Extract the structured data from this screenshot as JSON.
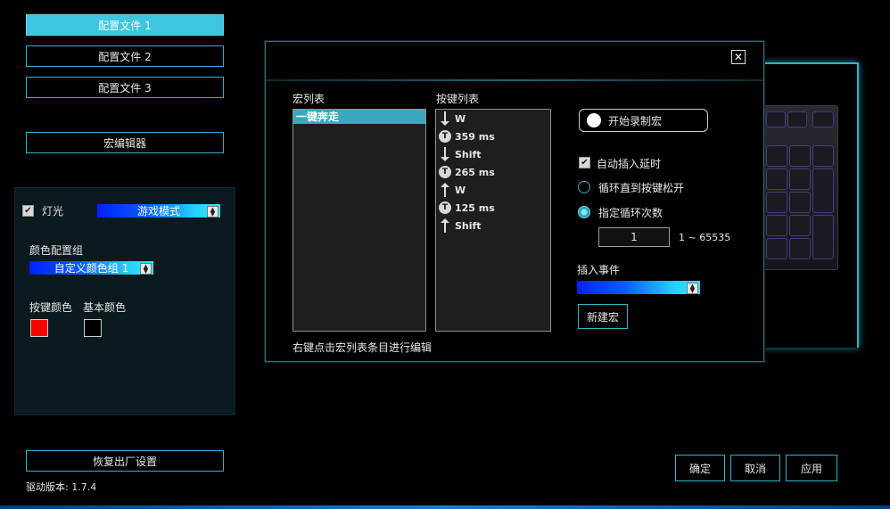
{
  "profiles": {
    "items": [
      {
        "label": "配置文件 1",
        "active": true
      },
      {
        "label": "配置文件 2",
        "active": false
      },
      {
        "label": "配置文件 3",
        "active": false
      }
    ],
    "macro_editor_label": "宏编辑器"
  },
  "lighting": {
    "enabled": true,
    "label": "灯光",
    "mode_value": "游戏模式",
    "color_group_label": "颜色配置组",
    "color_group_value": "自定义颜色组 1",
    "key_color_label": "按键颜色",
    "base_color_label": "基本颜色",
    "key_color": "#ff0000",
    "base_color": "#000000"
  },
  "footer": {
    "reset_label": "恢复出厂设置",
    "driver_version": "驱动版本: 1.7.4",
    "ok_label": "确定",
    "cancel_label": "取消",
    "apply_label": "应用"
  },
  "macro_dialog": {
    "close_icon": "close-icon",
    "macro_list_label": "宏列表",
    "macro_list": [
      "一键奔走"
    ],
    "key_list_label": "按键列表",
    "key_list": [
      {
        "type": "down",
        "text": "W"
      },
      {
        "type": "delay",
        "text": "359 ms"
      },
      {
        "type": "down",
        "text": "Shift"
      },
      {
        "type": "delay",
        "text": "265 ms"
      },
      {
        "type": "up",
        "text": "W"
      },
      {
        "type": "delay",
        "text": "125 ms"
      },
      {
        "type": "up",
        "text": "Shift"
      }
    ],
    "record_label": "开始录制宏",
    "auto_delay_label": "自动插入延时",
    "auto_delay_checked": true,
    "loop_until_release_label": "循环直到按键松开",
    "loop_count_label": "指定循环次数",
    "loop_count_value": "1",
    "loop_range": "1 ~ 65535",
    "insert_event_label": "插入事件",
    "new_macro_label": "新建宏",
    "hint": "右键点击宏列表条目进行编辑"
  }
}
